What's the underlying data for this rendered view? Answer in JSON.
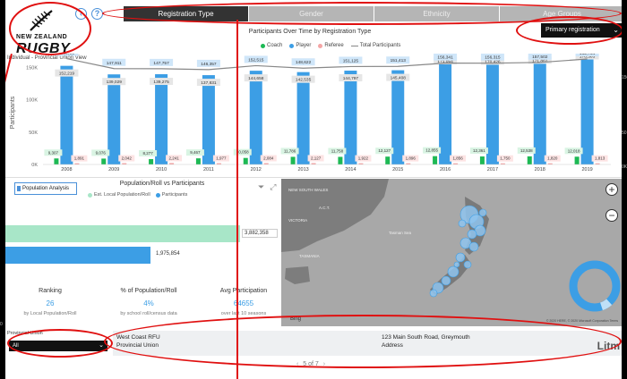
{
  "header": {
    "logo_line1": "NEW ZEALAND",
    "logo_line2": "RUGBY",
    "subtitle": "Individual - Provincial Union View",
    "back_icon": "back-arrow-icon",
    "help_icon": "help-icon"
  },
  "tabs": [
    {
      "label": "Registration Type",
      "active": true
    },
    {
      "label": "Gender",
      "active": false
    },
    {
      "label": "Ethnicity",
      "active": false
    },
    {
      "label": "Age Groups",
      "active": false
    }
  ],
  "registration_dropdown": {
    "value": "Primary registration"
  },
  "chart_data": {
    "type": "bar",
    "title": "Participants Over Time by Registration Type",
    "ylabel": "Participants",
    "y_ticks": [
      "0K",
      "50K",
      "100K",
      "150K"
    ],
    "ylim": [
      0,
      160000
    ],
    "categories": [
      "2008",
      "2009",
      "2010",
      "2011",
      "2012",
      "2013",
      "2014",
      "2015",
      "2016",
      "2017",
      "2018",
      "2019"
    ],
    "series": [
      {
        "name": "Coach",
        "color": "#1db954",
        "values": [
          9307,
          9076,
          8277,
          9467,
          10058,
          11786,
          11758,
          12127,
          12855,
          12361,
          12538,
          12018
        ],
        "labels": [
          "9,307",
          "9,076",
          "8,277",
          "9,467",
          "10,058",
          "11,786",
          "11,758",
          "12,127",
          "12,855",
          "12,361",
          "12,538",
          "12,018"
        ]
      },
      {
        "name": "Player",
        "color": "#3c9ee5",
        "values": [
          152219,
          139029,
          139275,
          137831,
          144658,
          142535,
          144797,
          145408,
          171054,
          170426,
          171861,
          178583
        ],
        "labels": [
          "152,219",
          "139,029",
          "139,275",
          "137,831",
          "144,658",
          "142,535",
          "144,797",
          "145,408",
          "171,054",
          "170,426",
          "171,861",
          "178,583"
        ]
      },
      {
        "name": "Referee",
        "color": "#f4a5a5",
        "values": [
          1891,
          2042,
          2241,
          1977,
          2084,
          2127,
          1922,
          1896,
          1856,
          1750,
          1820,
          1813
        ],
        "labels": [
          "1,891",
          "2,042",
          "2,241",
          "1,977",
          "2,084",
          "2,127",
          "1,922",
          "1,896",
          "1,856",
          "1,750",
          "1,820",
          "1,813"
        ]
      },
      {
        "name": "Total Participants",
        "color": "#888888",
        "values": [
          163321,
          147911,
          147757,
          146357,
          152515,
          148622,
          151125,
          151413,
          156341,
          156315,
          157502,
          162754
        ],
        "labels": [
          "163,321",
          "147,911",
          "147,757",
          "146,357",
          "152,515",
          "148,622",
          "151,125",
          "151,413",
          "156,341",
          "156,315",
          "157,502",
          "162,754"
        ]
      }
    ],
    "legend_position": "top-center"
  },
  "population": {
    "button_label": "Population Analysis",
    "title": "Population/Roll vs Participants",
    "legend": [
      {
        "name": "Est. Local Population/Roll",
        "color": "#a8e6c8"
      },
      {
        "name": "Participants",
        "color": "#3c9ee5"
      }
    ],
    "population_value": "3,882,358",
    "population_raw": 3882358,
    "participants_value": "1,975,854",
    "participants_raw": 1975854,
    "filter_icon": "filter-icon",
    "focus_icon": "focus-mode-icon"
  },
  "stats": [
    {
      "label": "Ranking",
      "value": "26",
      "foot": "by Local Population/Roll"
    },
    {
      "label": "% of Population/Roll",
      "value": "4%",
      "foot": "by school roll/census data"
    },
    {
      "label": "Avg Participation",
      "value": "64655",
      "foot": "over last 10 seasons"
    }
  ],
  "map": {
    "labels": [
      "NEW SOUTH WALES",
      "A.C.T.",
      "VICTORIA",
      "TASMANIA",
      "Tasman Sea"
    ],
    "provider": "Bing",
    "copyright": "© 2020 HERE, © 2020 Microsoft Corporation Terms",
    "zoom_in": "+",
    "zoom_out": "−",
    "donut_color": "#3c9ee5"
  },
  "footer": {
    "pu_label": "Provincial Union",
    "pu_value": "All",
    "card_name": "West Coast RFU",
    "card_type": "Provincial Union",
    "card_address": "123 Main South Road, Greymouth",
    "card_address_label": "Address",
    "brand": "Litm",
    "pager": "5 of 7"
  },
  "peek": {
    "right_150": "150",
    "right_50": "50",
    "right_0": "0K",
    "left_0": "0"
  }
}
